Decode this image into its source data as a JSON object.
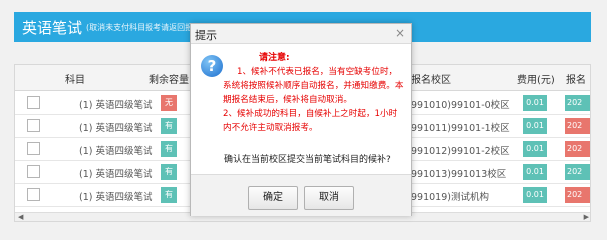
{
  "header": {
    "title": "英语笔试",
    "subtitle": "(取消未支付科目报考请返回报名信息页面进行操作)"
  },
  "table": {
    "columns": [
      "科目",
      "剩余容量",
      "报名校区",
      "费用(元)",
      "报名"
    ],
    "rows": [
      {
        "subject": "(1) 英语四级笔试",
        "capacity": "无",
        "capacity_color": "#e8766d",
        "school": "991010)99101-0校区",
        "fee": "0.01",
        "time": "202",
        "time_color": "#5ec1b6"
      },
      {
        "subject": "(1) 英语四级笔试",
        "capacity": "有",
        "capacity_color": "#5ec1b6",
        "school": "991011)99101-1校区",
        "fee": "0.01",
        "time": "202",
        "time_color": "#e8766d"
      },
      {
        "subject": "(1) 英语四级笔试",
        "capacity": "有",
        "capacity_color": "#5ec1b6",
        "school": "991012)99101-2校区",
        "fee": "0.01",
        "time": "202",
        "time_color": "#e8766d"
      },
      {
        "subject": "(1) 英语四级笔试",
        "capacity": "有",
        "capacity_color": "#5ec1b6",
        "school": "991013)991013校区",
        "fee": "0.01",
        "time": "202",
        "time_color": "#5ec1b6"
      },
      {
        "subject": "(1) 英语四级笔试",
        "capacity": "有",
        "capacity_color": "#5ec1b6",
        "school": "991019)测试机构",
        "fee": "0.01",
        "time": "202",
        "time_color": "#e8766d"
      }
    ]
  },
  "dialog": {
    "title": "提示",
    "close": "×",
    "icon": "question-icon",
    "attention": "请注意:",
    "line1": "1、候补不代表已报名，当有空缺考位时，系统将按照候补顺序自动报名，并通知缴费。本期报名结束后，候补将自动取消。",
    "line2": "2、候补成功的科目，自候补上之时起，1小时内不允许主动取消报考。",
    "confirm": "确认在当前校区提交当前笔试科目的候补?",
    "ok": "确定",
    "cancel": "取消"
  }
}
